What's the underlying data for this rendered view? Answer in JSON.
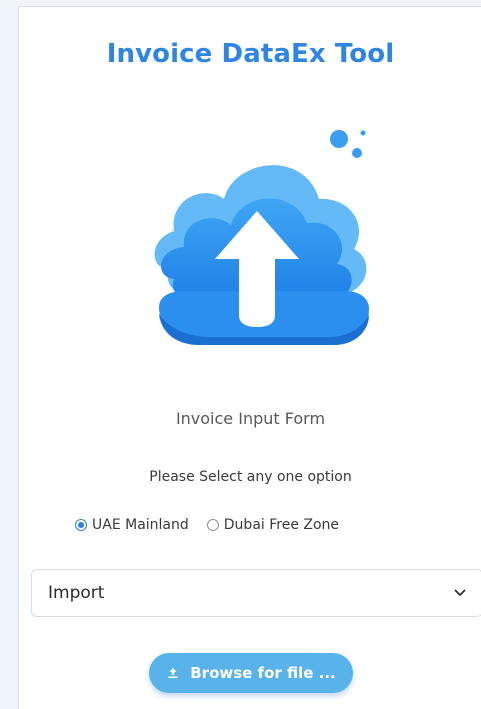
{
  "app": {
    "title": "Invoice DataEx Tool",
    "accent_color": "#2f86e2",
    "button_color": "#58b3ea"
  },
  "hero": {
    "icon": "cloud-upload-icon"
  },
  "form": {
    "label": "Invoice Input Form",
    "instruction": "Please Select any one option",
    "options": [
      {
        "label": "UAE Mainland",
        "checked": true
      },
      {
        "label": "Dubai Free Zone",
        "checked": false
      }
    ],
    "select": {
      "value": "Import",
      "icon": "chevron-down-icon"
    },
    "browse_button": {
      "label": "Browse for file ...",
      "icon": "upload-icon"
    }
  }
}
